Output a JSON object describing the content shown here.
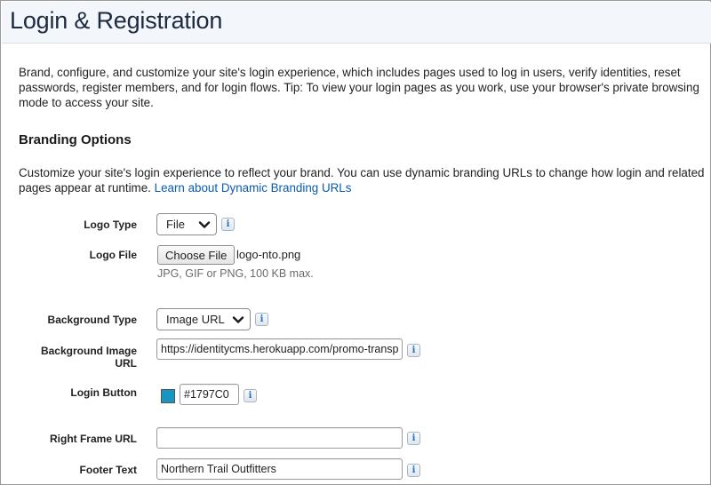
{
  "page": {
    "title": "Login & Registration",
    "intro": "Brand, configure, and customize your site's login experience, which includes pages used to log in users, verify identities, reset passwords, register members, and for login flows. Tip: To view your login pages as you work, use your browser's private browsing mode to access your site."
  },
  "branding": {
    "title": "Branding Options",
    "description": "Customize your site's login experience to reflect your brand. You can use dynamic branding URLs to change how login and related pages appear at runtime.",
    "learn_link": "Learn about Dynamic Branding URLs"
  },
  "form": {
    "logo_type": {
      "label": "Logo Type",
      "value": "File"
    },
    "logo_file": {
      "label": "Logo File",
      "button": "Choose File",
      "file_name": "logo-nto.png",
      "help": "JPG, GIF or PNG, 100 KB max."
    },
    "background_type": {
      "label": "Background Type",
      "value": "Image URL"
    },
    "background_image_url": {
      "label": "Background Image URL",
      "value": "https://identitycms.herokuapp.com/promo-transp"
    },
    "login_button": {
      "label": "Login Button",
      "value": "#1797C0",
      "color": "#1797C0"
    },
    "right_frame_url": {
      "label": "Right Frame URL",
      "value": ""
    },
    "footer_text": {
      "label": "Footer Text",
      "value": "Northern Trail Outfitters"
    }
  },
  "icons": {
    "info": "i",
    "chevron": "chevron-down-icon"
  }
}
